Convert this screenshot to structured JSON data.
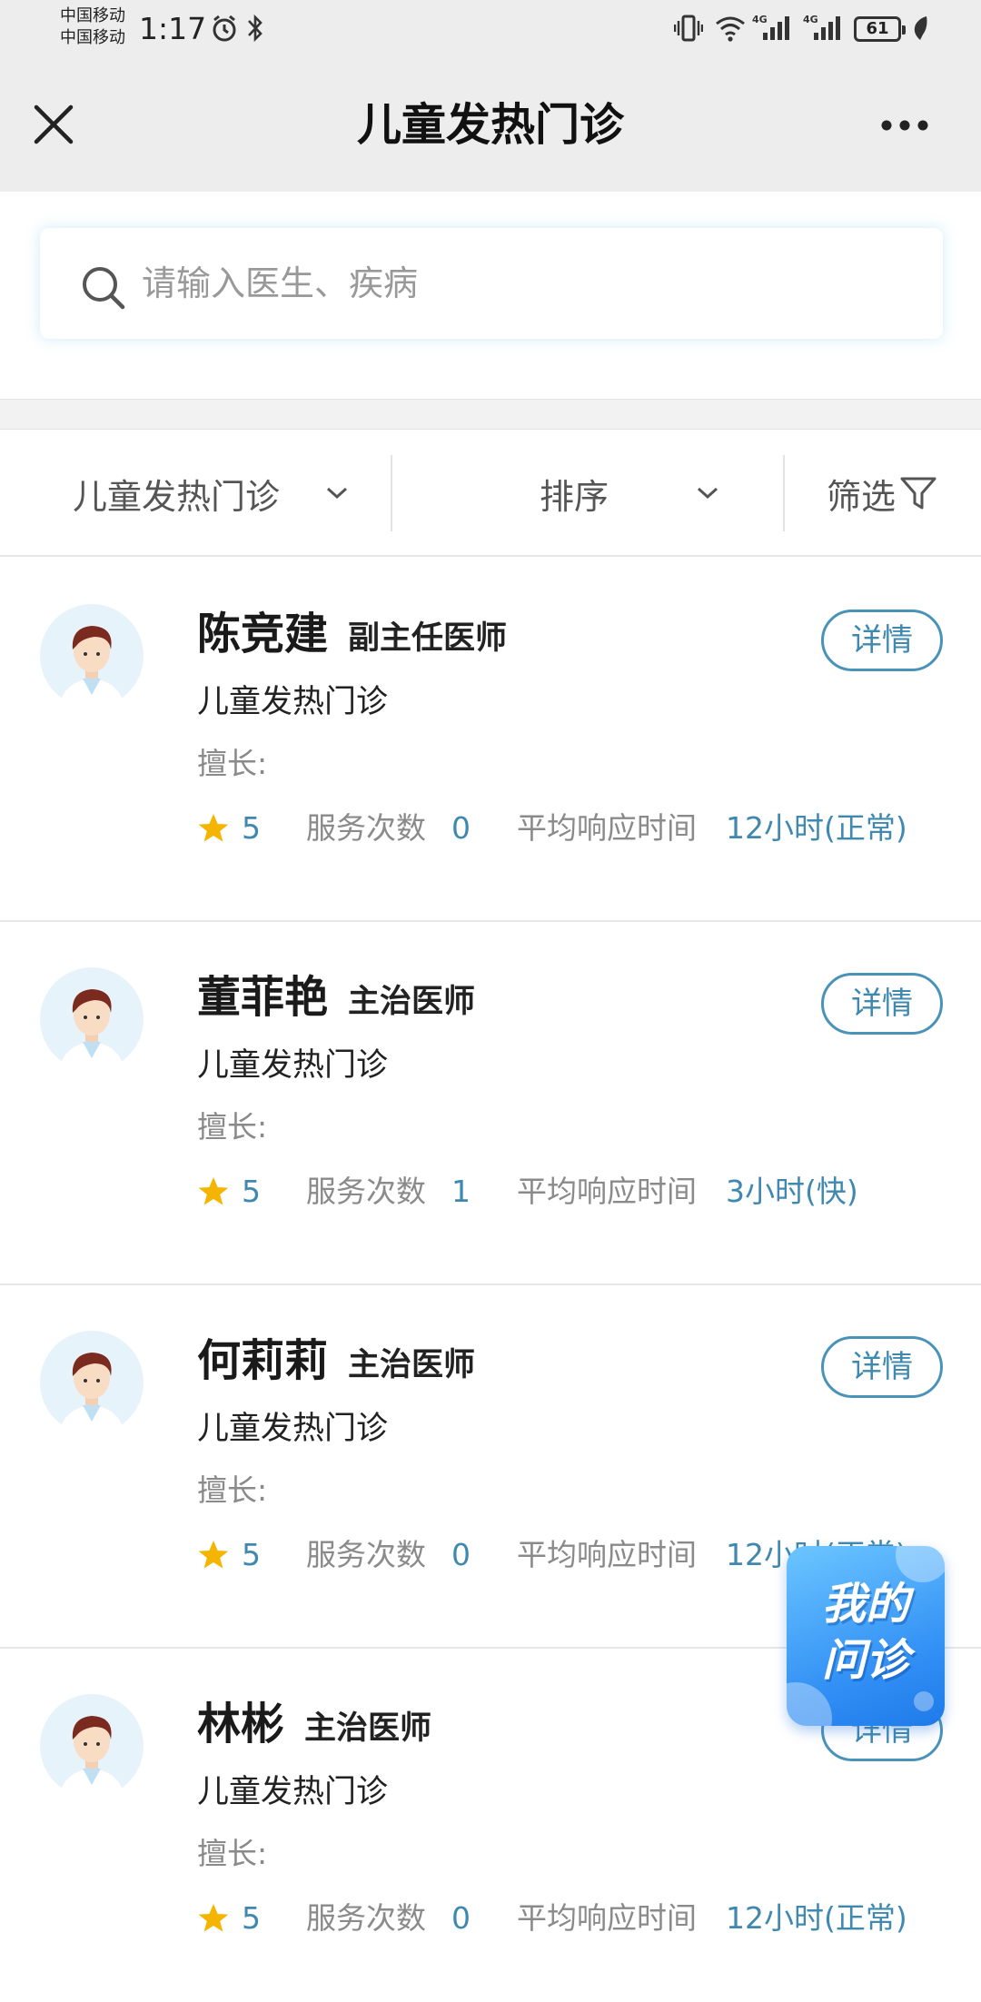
{
  "status_bar": {
    "carrier_1": "中国移动",
    "carrier_2": "中国移动",
    "time": "1:17",
    "battery": "61"
  },
  "header": {
    "title": "儿童发热门诊"
  },
  "search": {
    "placeholder": "请输入医生、疾病"
  },
  "filters": {
    "department": "儿童发热门诊",
    "sort": "排序",
    "filter": "筛选"
  },
  "labels": {
    "detail": "详情",
    "specialty": "擅长:",
    "service_count": "服务次数",
    "avg_response": "平均响应时间"
  },
  "doctors": [
    {
      "name": "陈竞建",
      "title": "副主任医师",
      "department": "儿童发热门诊",
      "rating": "5",
      "service_count": "0",
      "response_time": "12小时(正常)"
    },
    {
      "name": "董菲艳",
      "title": "主治医师",
      "department": "儿童发热门诊",
      "rating": "5",
      "service_count": "1",
      "response_time": "3小时(快)"
    },
    {
      "name": "何莉莉",
      "title": "主治医师",
      "department": "儿童发热门诊",
      "rating": "5",
      "service_count": "0",
      "response_time": "12小时(正常)"
    },
    {
      "name": "林彬",
      "title": "主治医师",
      "department": "儿童发热门诊",
      "rating": "5",
      "service_count": "0",
      "response_time": "12小时(正常)"
    }
  ],
  "floating_button": {
    "line1": "我的",
    "line2": "问诊"
  },
  "colors": {
    "accent": "#3f88b0",
    "star": "#f5b400",
    "fab": "#2f8df4"
  }
}
